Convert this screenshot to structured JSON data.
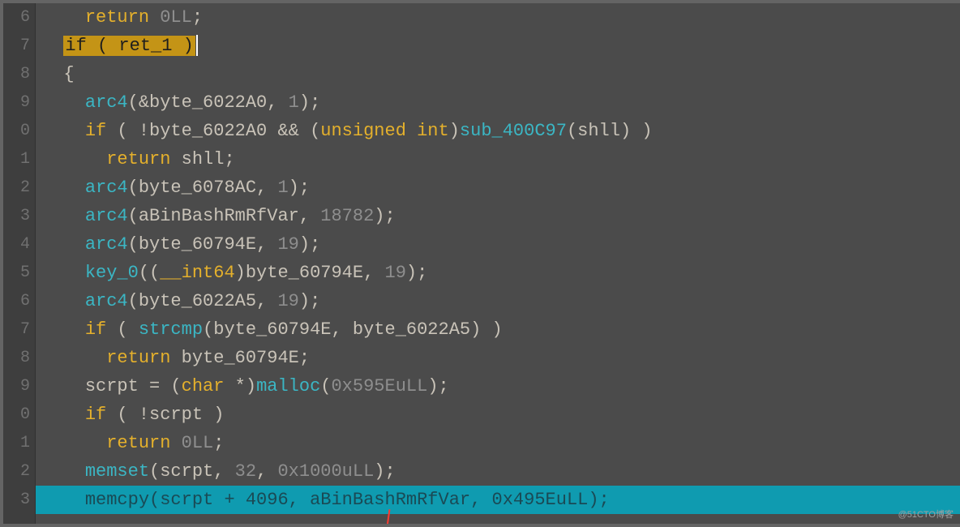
{
  "line_numbers": [
    "6",
    "7",
    "8",
    "9",
    "0",
    "1",
    "2",
    "3",
    "4",
    "5",
    "6",
    "7",
    "8",
    "9",
    "0",
    "1",
    "2",
    "3"
  ],
  "colors": {
    "background": "#4b4b4b",
    "gutter": "#3e3e3e",
    "highlight_line": "#0f9bb0",
    "keyword": "#e4b02c",
    "function": "#3bb6c4",
    "number": "#8e8e8e",
    "keyword_highlight_bg": "#c49416"
  },
  "lines": {
    "l0": {
      "indent": "    ",
      "kw": "return",
      "sp": " ",
      "num": "0LL",
      "punc": ";"
    },
    "l1": {
      "indent": "  ",
      "box": "if ( ret_1 )"
    },
    "l2": {
      "indent": "  ",
      "punc": "{"
    },
    "l3": {
      "indent": "    ",
      "fn": "arc4",
      "p1": "(&",
      "var": "byte_6022A0",
      "p2": ", ",
      "num": "1",
      "p3": ");"
    },
    "l4": {
      "indent": "    ",
      "kw": "if",
      "p1": " ( !",
      "var1": "byte_6022A0",
      "p2": " && (",
      "type": "unsigned int",
      "p3": ")",
      "fn": "sub_400C97",
      "p4": "(",
      "var2": "shll",
      "p5": ") )"
    },
    "l5": {
      "indent": "      ",
      "kw": "return",
      "sp": " ",
      "var": "shll",
      "punc": ";"
    },
    "l6": {
      "indent": "    ",
      "fn": "arc4",
      "p1": "(",
      "var": "byte_6078AC",
      "p2": ", ",
      "num": "1",
      "p3": ");"
    },
    "l7": {
      "indent": "    ",
      "fn": "arc4",
      "p1": "(",
      "var": "aBinBashRmRfVar",
      "p2": ", ",
      "num": "18782",
      "p3": ");"
    },
    "l8": {
      "indent": "    ",
      "fn": "arc4",
      "p1": "(",
      "var": "byte_60794E",
      "p2": ", ",
      "num": "19",
      "p3": ");"
    },
    "l9": {
      "indent": "    ",
      "fn": "key_0",
      "p1": "((",
      "type": "__int64",
      "p2": ")",
      "var": "byte_60794E",
      "p3": ", ",
      "num": "19",
      "p4": ");"
    },
    "l10": {
      "indent": "    ",
      "fn": "arc4",
      "p1": "(",
      "var": "byte_6022A5",
      "p2": ", ",
      "num": "19",
      "p3": ");"
    },
    "l11": {
      "indent": "    ",
      "kw": "if",
      "p1": " ( ",
      "fn": "strcmp",
      "p2": "(",
      "var1": "byte_60794E",
      "p3": ", ",
      "var2": "byte_6022A5",
      "p4": ") )"
    },
    "l12": {
      "indent": "      ",
      "kw": "return",
      "sp": " ",
      "var": "byte_60794E",
      "punc": ";"
    },
    "l13": {
      "indent": "    ",
      "var1": "scrpt",
      "p1": " = (",
      "type": "char",
      "p2": " *)",
      "fn": "malloc",
      "p3": "(",
      "num": "0x595EuLL",
      "p4": ");"
    },
    "l14": {
      "indent": "    ",
      "kw": "if",
      "p1": " ( !",
      "var": "scrpt",
      "p2": " )"
    },
    "l15": {
      "indent": "      ",
      "kw": "return",
      "sp": " ",
      "num": "0LL",
      "punc": ";"
    },
    "l16": {
      "indent": "    ",
      "fn": "memset",
      "p1": "(",
      "var": "scrpt",
      "p2": ", ",
      "num1": "32",
      "p3": ", ",
      "num2": "0x1000uLL",
      "p4": ");"
    },
    "l17": {
      "indent": "    ",
      "fn": "memcpy",
      "p1": "(",
      "var1": "scrpt",
      "p2": " + ",
      "num1": "4096",
      "p3": ", ",
      "var2": "aBinBashRmRfVar",
      "p4": ", ",
      "num2": "0x495EuLL",
      "p5": ");"
    }
  },
  "watermark": "@51CTO博客"
}
